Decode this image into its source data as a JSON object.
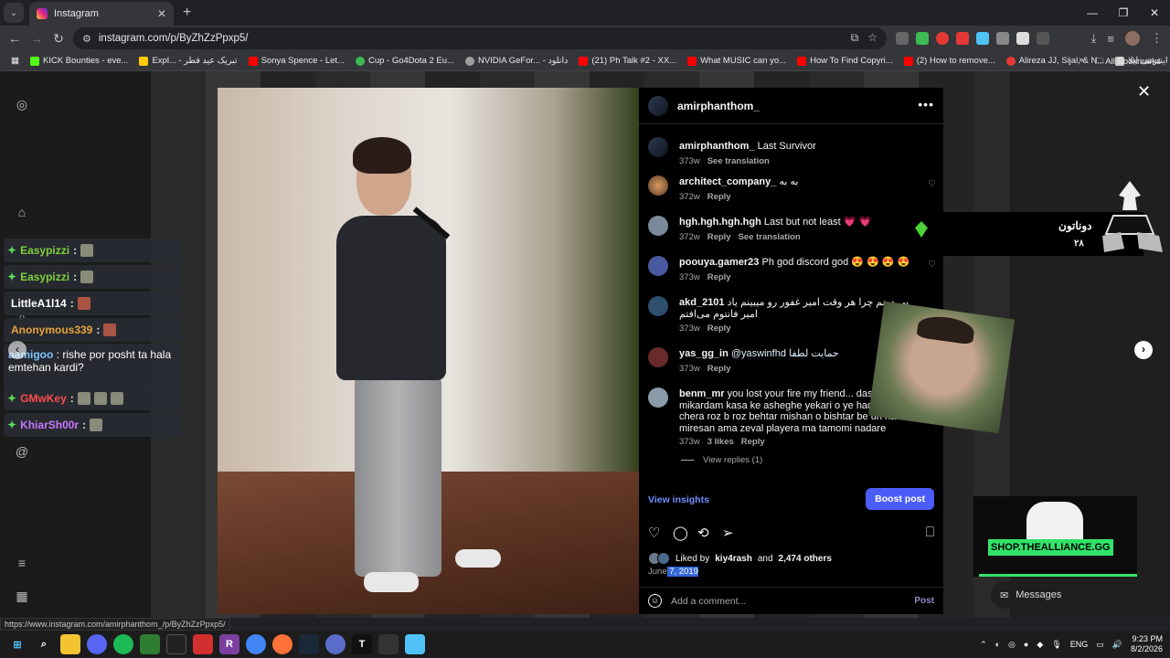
{
  "browser": {
    "tab_title": "Instagram",
    "url": "instagram.com/p/ByZhZzPpxp5/",
    "status_url": "https://www.instagram.com/amirphanthom_/p/ByZhZzPpxp5/",
    "bookmarks": [
      {
        "label": "KICK Bounties - eve...",
        "color": "#53fc18"
      },
      {
        "label": "Expl... - تبریک عید فطر",
        "color": "#ffcc00"
      },
      {
        "label": "Sonya Spence - Let...",
        "color": "#ff0000"
      },
      {
        "label": "Cup - Go4Dota 2 Eu...",
        "color": "#3cba54"
      },
      {
        "label": "NVIDIA GeFor... - دانلود",
        "color": "#9e9e9e"
      },
      {
        "label": "(21) Ph Talk #2 - XX...",
        "color": "#ff0000"
      },
      {
        "label": "What MUSIC can yo...",
        "color": "#ff0000"
      },
      {
        "label": "How To Find Copyri...",
        "color": "#ff0000"
      },
      {
        "label": "(2) How to remove...",
        "color": "#ff0000"
      },
      {
        "label": "Alireza JJ, Sijal, & N...",
        "color": "#e53935"
      },
      {
        "label": "فروشگاه اینترنتی ایلا...",
        "color": "#cccccc"
      }
    ],
    "all_bookmarks": "All Bookmarks"
  },
  "chat": [
    {
      "user": "Easypizzi",
      "color": "#7fd13b",
      "msg": ""
    },
    {
      "user": "Easypizzi",
      "color": "#7fd13b",
      "msg": ""
    },
    {
      "user": "LittleA1l14",
      "color": "#ffffff",
      "msg": ""
    },
    {
      "user": "Anonymous339",
      "color": "#e8a33b",
      "msg": ""
    },
    {
      "user": "aamigoo",
      "color": "#7ec8ff",
      "msg": "rishe por posht ta hala emtehan kardi?"
    },
    {
      "user": "GMwKey",
      "color": "#ff4d4d",
      "msg": ""
    },
    {
      "user": "KhiarSh00r",
      "color": "#c779ff",
      "msg": ""
    }
  ],
  "post": {
    "username": "amirphanthom_",
    "caption_user": "amirphanthom_",
    "caption_text": "Last Survivor",
    "caption_time": "373w",
    "see_translation": "See translation",
    "comments": [
      {
        "user": "architect_company_",
        "text": "به به",
        "time": "372w",
        "extra": "Reply",
        "extra2": "",
        "avatar": "#a06a40"
      },
      {
        "user": "hgh.hgh.hgh.hgh",
        "text": "Last but not least 💗 💗",
        "time": "372w",
        "extra": "Reply",
        "extra2": "See translation",
        "avatar": "#7a8a9a"
      },
      {
        "user": "poouya.gamer23",
        "text": "Ph god discord god 😍 😍 😍 😍",
        "time": "373w",
        "extra": "Reply",
        "extra2": "",
        "avatar": "#4a5aa0"
      },
      {
        "user": "akd_2101",
        "text": "بی دونم چرا هر وقت امیر غفور رو میبینم یاد امیر فانتوم می‌افتم",
        "time": "373w",
        "extra": "Reply",
        "extra2": "",
        "avatar": "#2f4f6f"
      },
      {
        "user": "yas_gg_in",
        "text": "@yaswinfhd حمایت لطفا",
        "time": "373w",
        "extra": "Reply",
        "extra2": "",
        "avatar": "#6a2a2a"
      },
      {
        "user": "benm_mr",
        "text": "you lost your fire my friend... dashtam fek mikardam kasa ke asheghe yekari o ye hadafi bodan chera roz b roz behtar mishan o bishtar be un hadafe miresan ama zeval playera ma tamomi nadare",
        "time": "373w",
        "extra": "3 likes",
        "extra2": "Reply",
        "avatar": "#8a9aa8"
      }
    ],
    "view_replies": "View replies (1)",
    "view_insights": "View insights",
    "boost_post": "Boost post",
    "liked_by": "Liked by",
    "liked_user": "kiy4rash",
    "and": "and",
    "others": "2,474 others",
    "date_prefix": "June",
    "date_selected": " 7, 2019",
    "add_comment": "Add a comment...",
    "post_label": "Post"
  },
  "overlays": {
    "donation_title": "دوناتون",
    "donation_amount": "۲۸",
    "shop_label": "SHOP.THEALLIANCE.GG",
    "messages_label": "Messages"
  },
  "taskbar": {
    "lang": "ENG",
    "time": "9:23 PM",
    "date": "8/2/2026"
  }
}
